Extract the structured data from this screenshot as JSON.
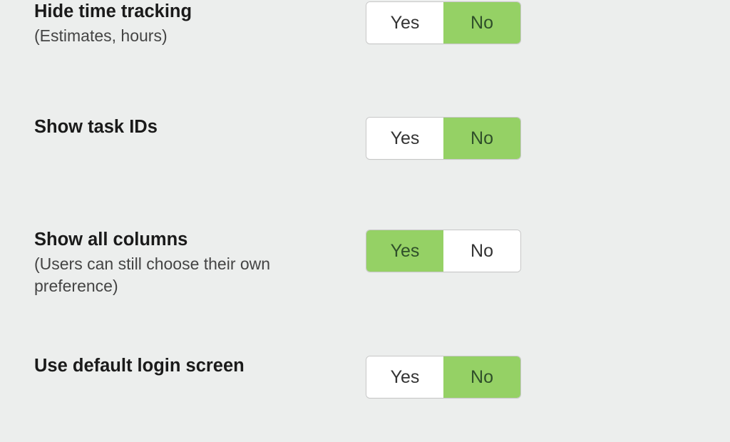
{
  "labels": {
    "yes": "Yes",
    "no": "No"
  },
  "settings": [
    {
      "key": "hide-time-tracking",
      "title": "Hide time tracking",
      "subtitle": "(Estimates, hours)",
      "selected": "no"
    },
    {
      "key": "show-task-ids",
      "title": "Show task IDs",
      "subtitle": "",
      "selected": "no"
    },
    {
      "key": "show-all-columns",
      "title": "Show all columns",
      "subtitle": "(Users can still choose their own preference)",
      "selected": "yes"
    },
    {
      "key": "use-default-login-screen",
      "title": "Use default login screen",
      "subtitle": "",
      "selected": "no"
    }
  ]
}
